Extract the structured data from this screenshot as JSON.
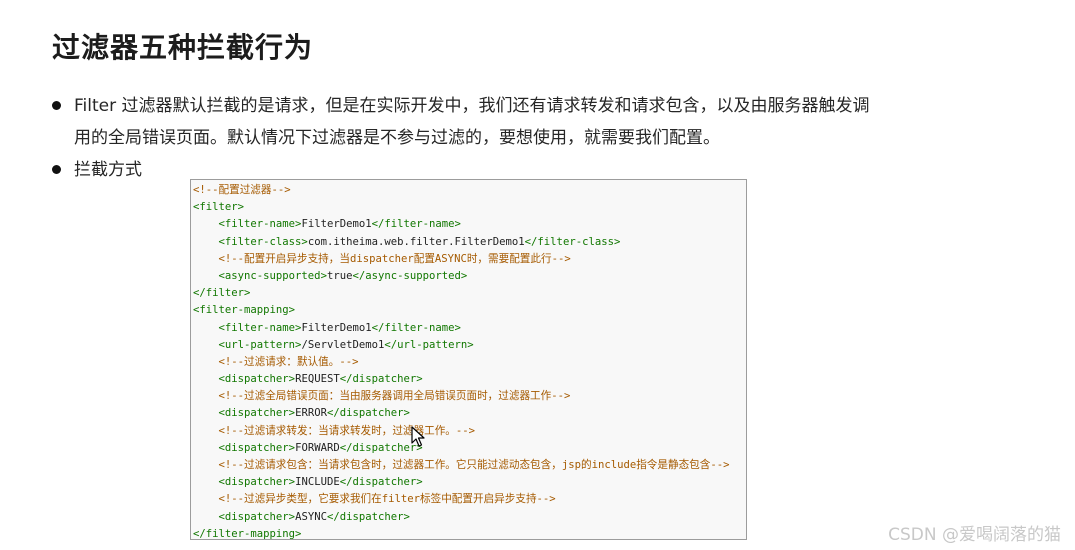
{
  "heading": "过滤器五种拦截行为",
  "bullets": [
    {
      "line1": "Filter 过滤器默认拦截的是请求，但是在实际开发中，我们还有请求转发和请求包含，以及由服务器触发调",
      "line2": "用的全局错误页面。默认情况下过滤器是不参与过滤的，要想使用，就需要我们配置。"
    },
    {
      "line1": "拦截方式"
    }
  ],
  "code_lines": [
    [
      {
        "t": "<!--配置过滤器-->",
        "k": "cmt"
      }
    ],
    [
      {
        "t": "<filter>",
        "k": "tag"
      }
    ],
    [
      {
        "t": "    ",
        "k": "txt"
      },
      {
        "t": "<filter-name>",
        "k": "tag"
      },
      {
        "t": "FilterDemo1",
        "k": "txt"
      },
      {
        "t": "</filter-name>",
        "k": "tag"
      }
    ],
    [
      {
        "t": "    ",
        "k": "txt"
      },
      {
        "t": "<filter-class>",
        "k": "tag"
      },
      {
        "t": "com.itheima.web.filter.FilterDemo1",
        "k": "txt"
      },
      {
        "t": "</filter-class>",
        "k": "tag"
      }
    ],
    [
      {
        "t": "    ",
        "k": "txt"
      },
      {
        "t": "<!--配置开启异步支持，当dispatcher配置ASYNC时，需要配置此行-->",
        "k": "cmt"
      }
    ],
    [
      {
        "t": "    ",
        "k": "txt"
      },
      {
        "t": "<async-supported>",
        "k": "tag"
      },
      {
        "t": "true",
        "k": "txt"
      },
      {
        "t": "</async-supported>",
        "k": "tag"
      }
    ],
    [
      {
        "t": "</filter>",
        "k": "tag"
      }
    ],
    [
      {
        "t": "<filter-mapping>",
        "k": "tag"
      }
    ],
    [
      {
        "t": "    ",
        "k": "txt"
      },
      {
        "t": "<filter-name>",
        "k": "tag"
      },
      {
        "t": "FilterDemo1",
        "k": "txt"
      },
      {
        "t": "</filter-name>",
        "k": "tag"
      }
    ],
    [
      {
        "t": "    ",
        "k": "txt"
      },
      {
        "t": "<url-pattern>",
        "k": "tag"
      },
      {
        "t": "/ServletDemo1",
        "k": "txt"
      },
      {
        "t": "</url-pattern>",
        "k": "tag"
      }
    ],
    [
      {
        "t": "    ",
        "k": "txt"
      },
      {
        "t": "<!--过滤请求：默认值。-->",
        "k": "cmt"
      }
    ],
    [
      {
        "t": "    ",
        "k": "txt"
      },
      {
        "t": "<dispatcher>",
        "k": "tag"
      },
      {
        "t": "REQUEST",
        "k": "txt"
      },
      {
        "t": "</dispatcher>",
        "k": "tag"
      }
    ],
    [
      {
        "t": "    ",
        "k": "txt"
      },
      {
        "t": "<!--过滤全局错误页面：当由服务器调用全局错误页面时，过滤器工作-->",
        "k": "cmt"
      }
    ],
    [
      {
        "t": "    ",
        "k": "txt"
      },
      {
        "t": "<dispatcher>",
        "k": "tag"
      },
      {
        "t": "ERROR",
        "k": "txt"
      },
      {
        "t": "</dispatcher>",
        "k": "tag"
      }
    ],
    [
      {
        "t": "    ",
        "k": "txt"
      },
      {
        "t": "<!--过滤请求转发：当请求转发时，过滤器工作。-->",
        "k": "cmt"
      }
    ],
    [
      {
        "t": "    ",
        "k": "txt"
      },
      {
        "t": "<dispatcher>",
        "k": "tag"
      },
      {
        "t": "FORWARD",
        "k": "txt"
      },
      {
        "t": "</dispatcher>",
        "k": "tag"
      }
    ],
    [
      {
        "t": "    ",
        "k": "txt"
      },
      {
        "t": "<!--过滤请求包含：当请求包含时，过滤器工作。它只能过滤动态包含，jsp的include指令是静态包含-->",
        "k": "cmt"
      }
    ],
    [
      {
        "t": "    ",
        "k": "txt"
      },
      {
        "t": "<dispatcher>",
        "k": "tag"
      },
      {
        "t": "INCLUDE",
        "k": "txt"
      },
      {
        "t": "</dispatcher>",
        "k": "tag"
      }
    ],
    [
      {
        "t": "    ",
        "k": "txt"
      },
      {
        "t": "<!--过滤异步类型，它要求我们在filter标签中配置开启异步支持-->",
        "k": "cmt"
      }
    ],
    [
      {
        "t": "    ",
        "k": "txt"
      },
      {
        "t": "<dispatcher>",
        "k": "tag"
      },
      {
        "t": "ASYNC",
        "k": "txt"
      },
      {
        "t": "</dispatcher>",
        "k": "tag"
      }
    ],
    [
      {
        "t": "</filter-mapping>",
        "k": "tag"
      }
    ]
  ],
  "colors": {
    "tag": "#117700",
    "comment": "#a55a00",
    "text": "#222222"
  },
  "watermark": "CSDN @爱喝阔落的猫"
}
